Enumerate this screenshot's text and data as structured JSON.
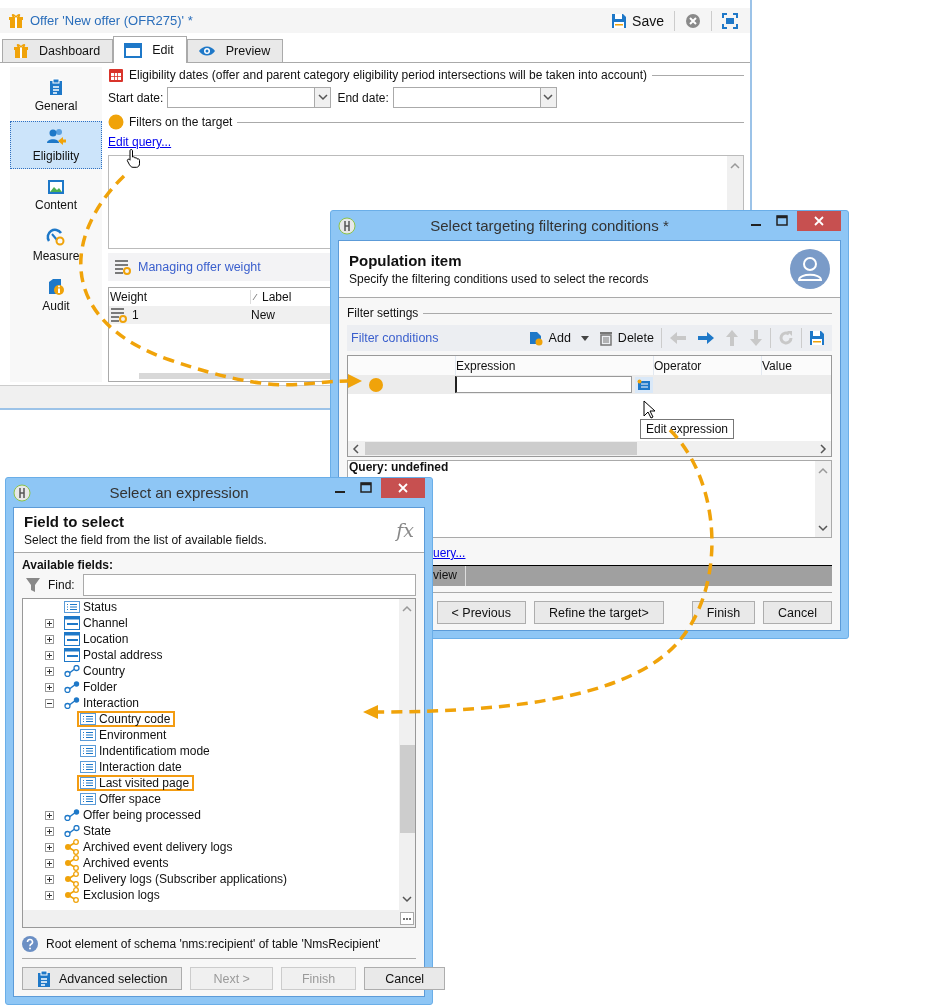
{
  "main_window": {
    "title": "Offer 'New offer (OFR275)' *",
    "save_label": "Save",
    "tabs": [
      {
        "label": "Dashboard",
        "selected": false
      },
      {
        "label": "Edit",
        "selected": true
      },
      {
        "label": "Preview",
        "selected": false
      }
    ],
    "sidebar": [
      {
        "label": "General",
        "selected": false
      },
      {
        "label": "Eligibility",
        "selected": true
      },
      {
        "label": "Content",
        "selected": false
      },
      {
        "label": "Measure",
        "selected": false
      },
      {
        "label": "Audit",
        "selected": false
      }
    ],
    "eligibility": {
      "heading": "Eligibility dates (offer and parent category eligibility period intersections will be taken into account)",
      "start_label": "Start date:",
      "end_label": "End date:"
    },
    "filters": {
      "heading": "Filters on the target",
      "link": "Edit query..."
    },
    "weight_panel": {
      "title": "Managing offer weight",
      "columns": [
        "Weight",
        "Label"
      ],
      "rows": [
        [
          "1",
          "New"
        ]
      ]
    }
  },
  "filter_dialog": {
    "title": "Select targeting filtering conditions *",
    "heading": "Population item",
    "subtitle": "Specify the filtering conditions used to select the records",
    "section": "Filter settings",
    "toolbar_title": "Filter conditions",
    "add_label": "Add",
    "delete_label": "Delete",
    "nav_buttons": [
      {
        "kind": "left",
        "disabled": true
      },
      {
        "kind": "right",
        "disabled": false
      },
      {
        "kind": "up",
        "disabled": true
      },
      {
        "kind": "down",
        "disabled": true
      },
      {
        "kind": "refresh",
        "disabled": true
      },
      {
        "kind": "save",
        "disabled": false
      }
    ],
    "columns": [
      "Expression",
      "Operator",
      "Value"
    ],
    "tooltip": "Edit expression",
    "query": "Query: undefined",
    "link": "uery...",
    "tab": "view",
    "buttons": [
      {
        "label": "< Previous",
        "disabled": false
      },
      {
        "label": "Refine the target>",
        "disabled": false
      },
      {
        "label": "Finish",
        "disabled": false
      },
      {
        "label": "Cancel",
        "disabled": false
      }
    ]
  },
  "expression_dialog": {
    "title": "Select an expression",
    "heading": "Field to select",
    "subtitle": "Select the field from the list of available fields.",
    "fx": "fx",
    "fields_label": "Available fields:",
    "find_label": "Find:",
    "tree": [
      {
        "label": "Status",
        "kind": "field",
        "highlighted": false
      },
      {
        "label": "Channel",
        "kind": "table",
        "expanded": false,
        "highlighted": false
      },
      {
        "label": "Location",
        "kind": "table",
        "expanded": false,
        "highlighted": false
      },
      {
        "label": "Postal address",
        "kind": "table",
        "expanded": false,
        "highlighted": false
      },
      {
        "label": "Country",
        "kind": "link-open",
        "expanded": false,
        "highlighted": false
      },
      {
        "label": "Folder",
        "kind": "link",
        "expanded": false,
        "highlighted": false
      },
      {
        "label": "Interaction",
        "kind": "link",
        "expanded": true,
        "highlighted": false,
        "children": [
          {
            "label": "Country code",
            "kind": "field",
            "highlighted": true
          },
          {
            "label": "Environment",
            "kind": "field",
            "highlighted": false
          },
          {
            "label": "Indentificatiom mode",
            "kind": "field",
            "highlighted": false
          },
          {
            "label": "Interaction date",
            "kind": "field",
            "highlighted": false
          },
          {
            "label": "Last visited page",
            "kind": "field",
            "highlighted": true
          },
          {
            "label": "Offer space",
            "kind": "field",
            "highlighted": false
          }
        ]
      },
      {
        "label": "Offer being processed",
        "kind": "link",
        "expanded": false,
        "highlighted": false
      },
      {
        "label": "State",
        "kind": "link-open",
        "expanded": false,
        "highlighted": false
      },
      {
        "label": "Archived event delivery logs",
        "kind": "collection",
        "expanded": false,
        "highlighted": false
      },
      {
        "label": "Archived events",
        "kind": "collection",
        "expanded": false,
        "highlighted": false
      },
      {
        "label": "Delivery logs (Subscriber applications)",
        "kind": "collection",
        "expanded": false,
        "highlighted": false
      },
      {
        "label": "Exclusion logs",
        "kind": "collection",
        "expanded": false,
        "highlighted": false
      }
    ],
    "hint": "Root element of schema 'nms:recipient' of table 'NmsRecipient'",
    "buttons": [
      {
        "label": "Advanced selection",
        "disabled": false
      },
      {
        "label": "Next >",
        "disabled": true
      },
      {
        "label": "Finish",
        "disabled": true
      },
      {
        "label": "Cancel",
        "disabled": false
      }
    ]
  }
}
